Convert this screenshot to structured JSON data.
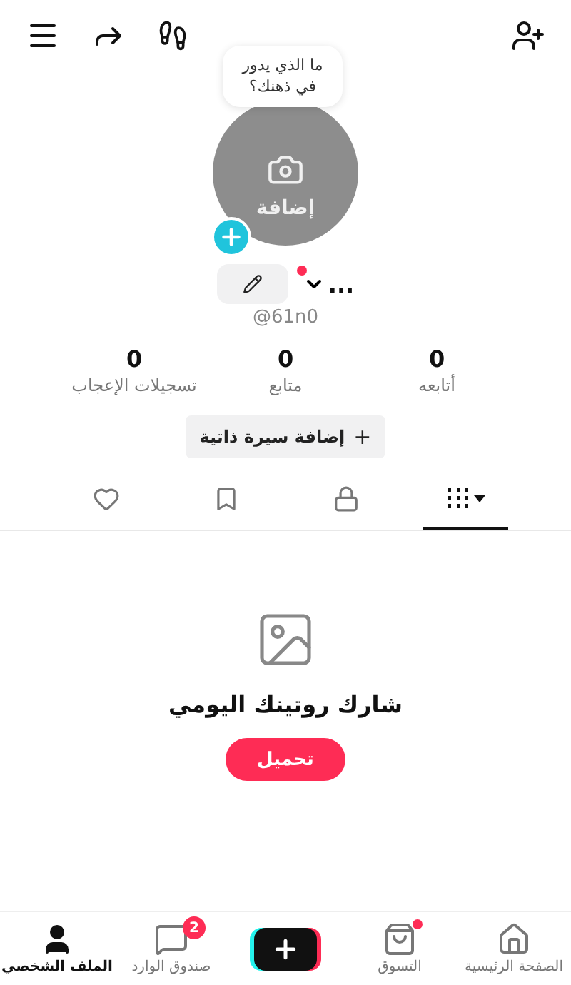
{
  "header": {
    "tooltip": "ما الذي يدور في ذهنك؟",
    "avatar_label": "إضافة"
  },
  "profile": {
    "name": "...",
    "has_notification": true,
    "handle": "@61n0"
  },
  "stats": [
    {
      "value": "0",
      "label": "أتابعه"
    },
    {
      "value": "0",
      "label": "متابع"
    },
    {
      "value": "0",
      "label": "تسجيلات الإعجاب"
    }
  ],
  "bio_button": {
    "icon": "+",
    "label": "إضافة سيرة ذاتية"
  },
  "tabs": [
    {
      "kind": "videos",
      "selected": true
    },
    {
      "kind": "private",
      "selected": false
    },
    {
      "kind": "saved",
      "selected": false
    },
    {
      "kind": "liked",
      "selected": false
    }
  ],
  "empty_state": {
    "title": "شارك روتينك اليومي",
    "button": "تحميل"
  },
  "bottom_nav": [
    {
      "kind": "home",
      "label": "الصفحة الرئيسية",
      "selected": false
    },
    {
      "kind": "shop",
      "label": "التسوق",
      "selected": false,
      "dot": true
    },
    {
      "kind": "create"
    },
    {
      "kind": "inbox",
      "label": "صندوق الوارد",
      "selected": false,
      "badge": "2"
    },
    {
      "kind": "profile",
      "label": "الملف الشخصي",
      "selected": true
    }
  ]
}
